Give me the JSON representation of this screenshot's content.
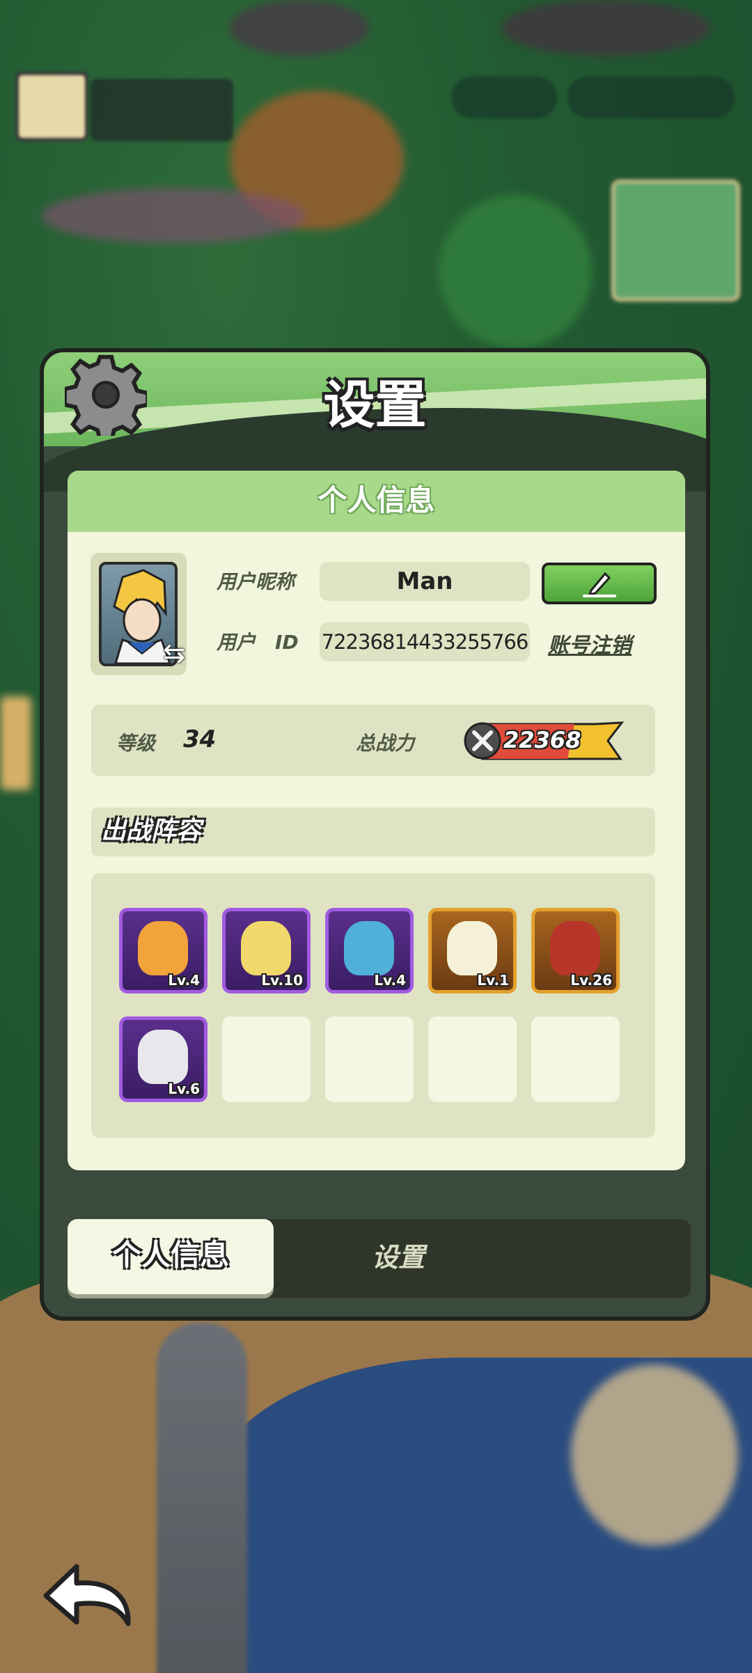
{
  "modal": {
    "title": "设置",
    "section_title": "个人信息"
  },
  "profile": {
    "nickname_label": "用户昵称",
    "nickname_value": "Man",
    "id_label": "用户　ID",
    "id_value": "72236814433255766",
    "delete_account_link": "账号注销"
  },
  "stats": {
    "level_label": "等级",
    "level_value": "34",
    "power_label": "总战力",
    "power_value": "22368"
  },
  "lineup": {
    "title": "出战阵容",
    "heroes": [
      {
        "level": "Lv.4",
        "rarity": "purple"
      },
      {
        "level": "Lv.10",
        "rarity": "purple"
      },
      {
        "level": "Lv.4",
        "rarity": "purple"
      },
      {
        "level": "Lv.1",
        "rarity": "gold"
      },
      {
        "level": "Lv.26",
        "rarity": "gold"
      },
      {
        "level": "Lv.6",
        "rarity": "purple"
      }
    ],
    "empty_slots": 4
  },
  "tabs": {
    "personal_info": "个人信息",
    "settings": "设置"
  },
  "colors": {
    "header_green": "#8fcf7a",
    "panel_bg": "#f1f6dc",
    "edit_button": "#5fb84a",
    "purple_rarity": "#a15be0",
    "gold_rarity": "#e3a12d"
  }
}
